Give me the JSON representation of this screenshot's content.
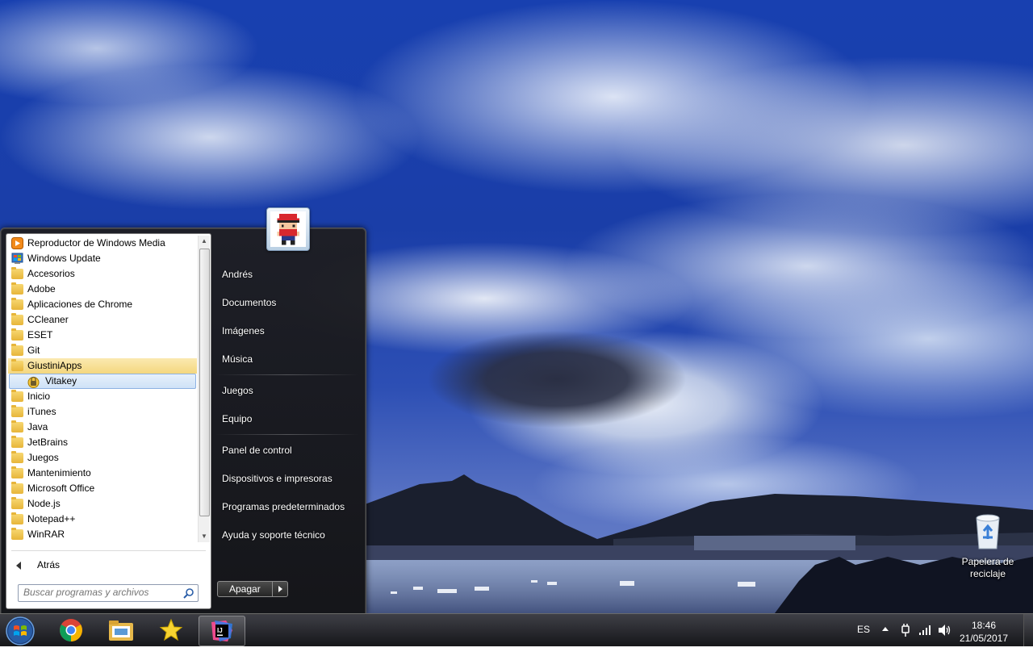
{
  "desktop": {
    "recycle_bin_label": "Papelera de reciclaje"
  },
  "start_menu": {
    "programs": [
      {
        "label": "Reproductor de Windows Media",
        "icon": "media-player-icon"
      },
      {
        "label": "Windows Update",
        "icon": "windows-update-icon"
      },
      {
        "label": "Accesorios",
        "icon": "folder-icon"
      },
      {
        "label": "Adobe",
        "icon": "folder-icon"
      },
      {
        "label": "Aplicaciones de Chrome",
        "icon": "folder-icon"
      },
      {
        "label": "CCleaner",
        "icon": "folder-icon"
      },
      {
        "label": "ESET",
        "icon": "folder-icon"
      },
      {
        "label": "Git",
        "icon": "folder-icon"
      },
      {
        "label": "GiustiniApps",
        "icon": "folder-icon",
        "state": "highlighted"
      },
      {
        "label": "Vitakey",
        "icon": "vitakey-icon",
        "state": "selected",
        "indent": true
      },
      {
        "label": "Inicio",
        "icon": "folder-icon"
      },
      {
        "label": "iTunes",
        "icon": "folder-icon"
      },
      {
        "label": "Java",
        "icon": "folder-icon"
      },
      {
        "label": "JetBrains",
        "icon": "folder-icon"
      },
      {
        "label": "Juegos",
        "icon": "folder-icon"
      },
      {
        "label": "Mantenimiento",
        "icon": "folder-icon"
      },
      {
        "label": "Microsoft Office",
        "icon": "folder-icon"
      },
      {
        "label": "Node.js",
        "icon": "folder-icon"
      },
      {
        "label": "Notepad++",
        "icon": "folder-icon"
      },
      {
        "label": "WinRAR",
        "icon": "folder-icon"
      }
    ],
    "back_label": "Atrás",
    "search_placeholder": "Buscar programas y archivos",
    "right_items": {
      "user": "Andrés",
      "documents": "Documentos",
      "pictures": "Imágenes",
      "music": "Música",
      "games": "Juegos",
      "computer": "Equipo",
      "control_panel": "Panel de control",
      "devices": "Dispositivos e impresoras",
      "default_programs": "Programas predeterminados",
      "help": "Ayuda y soporte técnico"
    },
    "shutdown_label": "Apagar"
  },
  "taskbar": {
    "apps": [
      "chrome-icon",
      "file-explorer-icon",
      "favorites-star-icon",
      "intellij-idea-icon"
    ],
    "language": "ES",
    "time": "18:46",
    "date": "21/05/2017"
  },
  "colors": {
    "highlight": "#f4d77e",
    "selection": "#cfe2f7",
    "sky": "#1840b0"
  }
}
